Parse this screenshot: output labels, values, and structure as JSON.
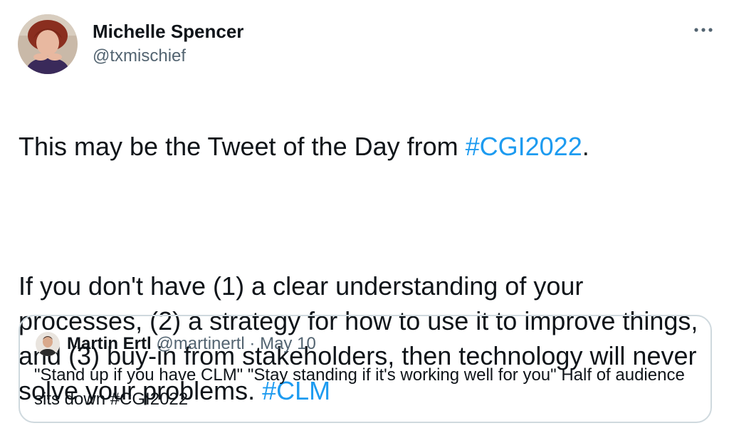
{
  "author": {
    "name": "Michelle Spencer",
    "handle": "@txmischief"
  },
  "tweet": {
    "line1_text": "This may be the Tweet of the Day from ",
    "line1_hashtag": "#CGI2022",
    "line1_end": ".",
    "para2_text": "If you don't have (1) a clear understanding of your processes, (2) a strategy for how to use it to improve things, and (3) buy-in from stakeholders, then technology will never solve your problems. ",
    "para2_hashtag": "#CLM"
  },
  "more_icon": "more-horizontal-icon",
  "quote": {
    "name": "Martin Ertl",
    "handle": "@martinertl",
    "separator": "·",
    "date": "May 10",
    "text": "\"Stand up if you have CLM\" \"Stay standing if it's working well for you\" Half of audience sits down #CGI2022"
  },
  "colors": {
    "hashtag": "#1d9bf0",
    "secondary_text": "#536471",
    "border": "#cfd9de"
  }
}
